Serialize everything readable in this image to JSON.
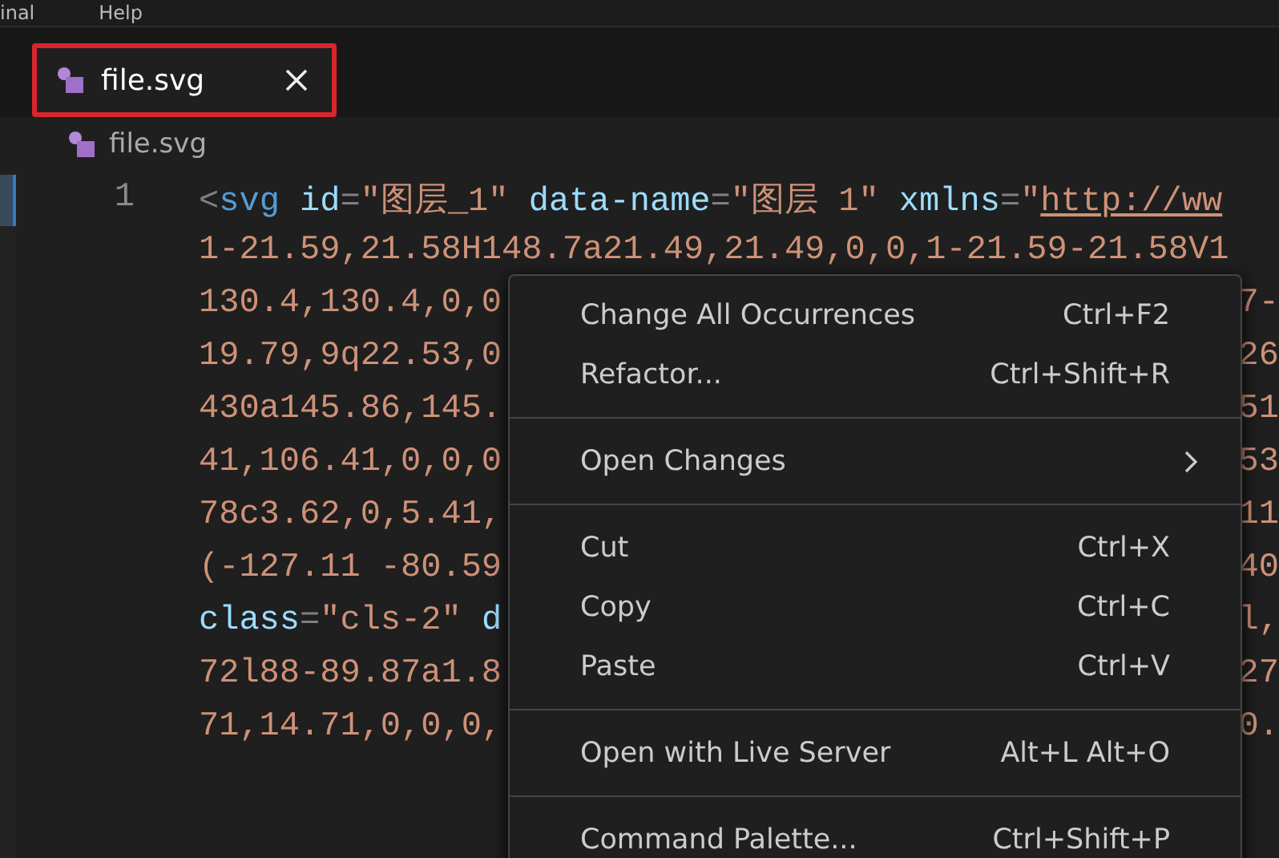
{
  "menu_bar": [
    "inal",
    "Help"
  ],
  "tabs": [
    {
      "label": "file.svg",
      "selected": true,
      "highlighted": true
    }
  ],
  "breadcrumb": "file.svg",
  "editor": {
    "line_number": "1",
    "rows": [
      {
        "tokens": [
          {
            "kind": "punct",
            "text": "<"
          },
          {
            "kind": "tag",
            "text": "svg"
          },
          {
            "kind": "attr",
            "text": " id"
          },
          {
            "kind": "punct",
            "text": "="
          },
          {
            "kind": "string",
            "text": "\"图层_1\""
          },
          {
            "kind": "attr",
            "text": " data-name"
          },
          {
            "kind": "punct",
            "text": "="
          },
          {
            "kind": "string",
            "text": "\"图层 1\""
          },
          {
            "kind": "attr",
            "text": " xmlns"
          },
          {
            "kind": "punct",
            "text": "="
          },
          {
            "kind": "string",
            "text": "\""
          },
          {
            "kind": "link",
            "text": "http://ww"
          }
        ]
      },
      {
        "tokens": [
          {
            "kind": "string",
            "text": "1-21.59,21.58H148.7a21.49,21.49,0,0,1-21.59-21.58V1"
          }
        ]
      },
      {
        "tokens": [
          {
            "kind": "string",
            "text": "130.4,130.4,0,0"
          }
        ],
        "tail": "7-"
      },
      {
        "tokens": [
          {
            "kind": "string",
            "text": "19.79,9q22.53,0"
          }
        ],
        "tail": "26"
      },
      {
        "tokens": [
          {
            "kind": "string",
            "text": "430a145.86,145."
          }
        ],
        "tail": "51"
      },
      {
        "tokens": [
          {
            "kind": "string",
            "text": "41,106.41,0,0,0"
          }
        ],
        "tail": "53"
      },
      {
        "tokens": [
          {
            "kind": "string",
            "text": "78c3.62,0,5.41,"
          }
        ],
        "tail": "11"
      },
      {
        "tokens": [
          {
            "kind": "string",
            "text": "(-127.11 -80.59"
          }
        ],
        "tail": "40"
      },
      {
        "tokens": [
          {
            "kind": "attr",
            "text": "class"
          },
          {
            "kind": "punct",
            "text": "="
          },
          {
            "kind": "string",
            "text": "\"cls-2\""
          },
          {
            "kind": "attr",
            "text": " d"
          }
        ],
        "tail": "l,"
      },
      {
        "tokens": [
          {
            "kind": "string",
            "text": "72l88-89.87a1.8"
          }
        ],
        "tail": "27"
      },
      {
        "tokens": [
          {
            "kind": "string",
            "text": "71,14.71,0,0,0,"
          }
        ],
        "tail": "0."
      }
    ]
  },
  "context_menu": [
    {
      "kind": "item",
      "label": "Change All Occurrences",
      "shortcut": "Ctrl+F2",
      "submenu": false
    },
    {
      "kind": "item",
      "label": "Refactor...",
      "shortcut": "Ctrl+Shift+R",
      "submenu": false
    },
    {
      "kind": "separator"
    },
    {
      "kind": "item",
      "label": "Open Changes",
      "submenu": true
    },
    {
      "kind": "separator"
    },
    {
      "kind": "item",
      "label": "Cut",
      "shortcut": "Ctrl+X",
      "submenu": false
    },
    {
      "kind": "item",
      "label": "Copy",
      "shortcut": "Ctrl+C",
      "submenu": false
    },
    {
      "kind": "item",
      "label": "Paste",
      "shortcut": "Ctrl+V",
      "submenu": false
    },
    {
      "kind": "separator"
    },
    {
      "kind": "item",
      "label": "Open with Live Server",
      "shortcut": "Alt+L Alt+O",
      "submenu": false
    },
    {
      "kind": "separator"
    },
    {
      "kind": "item",
      "label": "Command Palette...",
      "shortcut": "Ctrl+Shift+P",
      "submenu": false
    }
  ]
}
